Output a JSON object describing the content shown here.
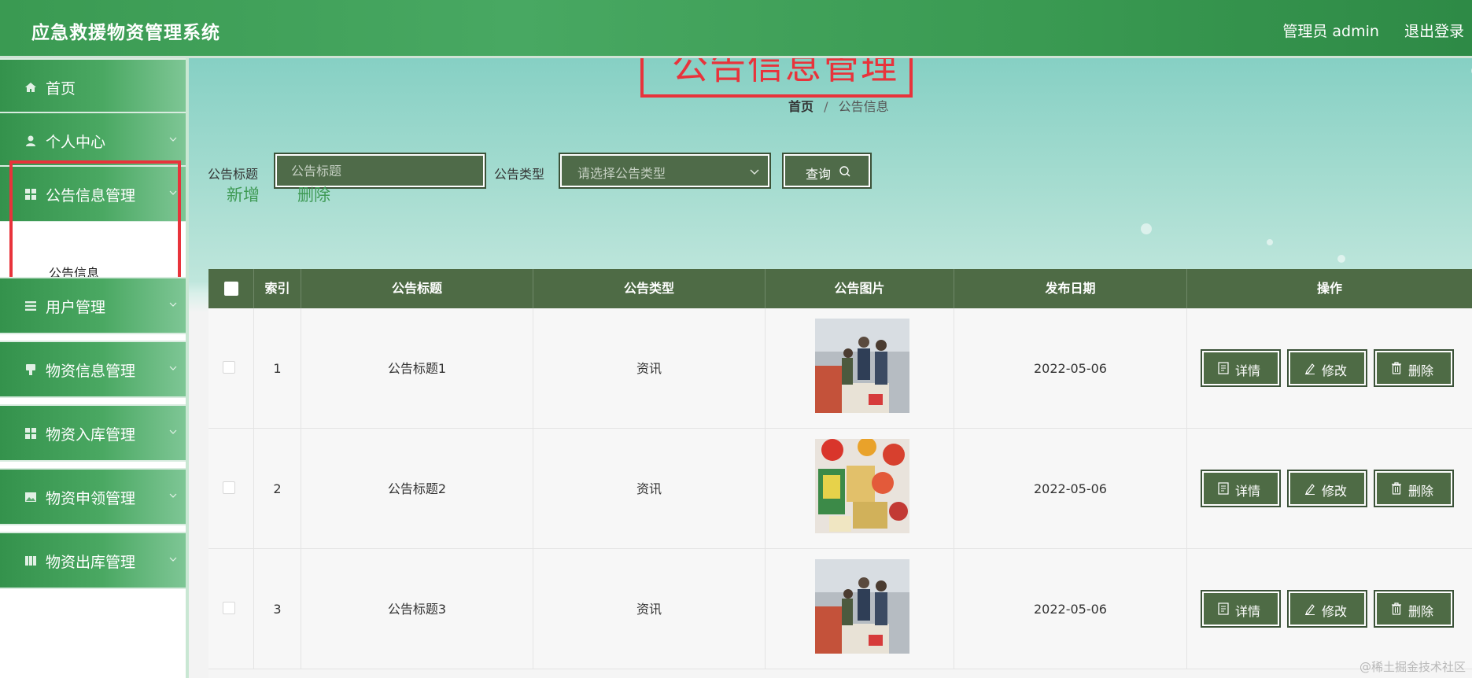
{
  "app": {
    "title": "应急救援物资管理系统",
    "user_label": "管理员 admin",
    "logout_label": "退出登录"
  },
  "sidebar": {
    "items": [
      {
        "label": "首页",
        "icon": "home-icon",
        "has_arrow": false
      },
      {
        "label": "个人中心",
        "icon": "user-icon",
        "has_arrow": true
      },
      {
        "label": "公告信息管理",
        "icon": "grid-icon",
        "has_arrow": true,
        "expanded": true
      },
      {
        "label": "用户管理",
        "icon": "list-icon",
        "has_arrow": true
      },
      {
        "label": "物资信息管理",
        "icon": "tag-icon",
        "has_arrow": true
      },
      {
        "label": "物资入库管理",
        "icon": "grid-icon",
        "has_arrow": true
      },
      {
        "label": "物资申领管理",
        "icon": "picture-icon",
        "has_arrow": true
      },
      {
        "label": "物资出库管理",
        "icon": "book-icon",
        "has_arrow": true
      }
    ],
    "submenu": {
      "label": "公告信息"
    }
  },
  "page": {
    "heading": "公告信息管理",
    "breadcrumb": {
      "home": "首页",
      "separator": "/",
      "current": "公告信息"
    }
  },
  "search": {
    "title_label": "公告标题",
    "title_placeholder": "公告标题",
    "type_label": "公告类型",
    "type_placeholder": "请选择公告类型",
    "query_label": "查询"
  },
  "actions": {
    "add": "新增",
    "delete": "删除"
  },
  "table": {
    "columns": [
      "索引",
      "公告标题",
      "公告类型",
      "公告图片",
      "发布日期",
      "操作"
    ],
    "rows": [
      {
        "index": "1",
        "title": "公告标题1",
        "type": "资讯",
        "image": "photo-people-supplies",
        "date": "2022-05-06"
      },
      {
        "index": "2",
        "title": "公告标题2",
        "type": "资讯",
        "image": "photo-food-table",
        "date": "2022-05-06"
      },
      {
        "index": "3",
        "title": "公告标题3",
        "type": "资讯",
        "image": "photo-people-supplies",
        "date": "2022-05-06"
      }
    ],
    "row_buttons": {
      "detail": "详情",
      "edit": "修改",
      "delete": "删除"
    }
  },
  "watermark": "@稀土掘金技术社区",
  "colors": {
    "brand_green": "#3a9a52",
    "table_header": "#4e6b45",
    "highlight_red": "#e8333b",
    "link_green": "#3f9a55"
  }
}
